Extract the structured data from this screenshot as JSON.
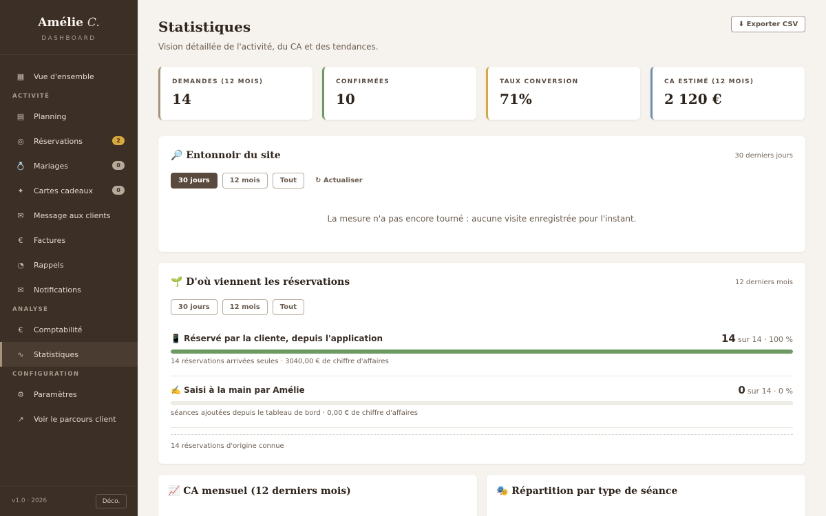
{
  "sidebar": {
    "brand_name": "Amélie",
    "brand_initial": "C.",
    "brand_sub": "DASHBOARD",
    "overview": {
      "label": "Vue d'ensemble",
      "icon": "▦"
    },
    "sections": {
      "activite": "ACTIVITÉ",
      "analyse": "ANALYSE",
      "configuration": "CONFIGURATION"
    },
    "items": {
      "planning": {
        "label": "Planning",
        "icon": "▤"
      },
      "reservations": {
        "label": "Réservations",
        "icon": "◎",
        "badge": "2"
      },
      "mariages": {
        "label": "Mariages",
        "icon": "💍",
        "badge": "0"
      },
      "cartes": {
        "label": "Cartes cadeaux",
        "icon": "✦",
        "badge": "0"
      },
      "message": {
        "label": "Message aux clients",
        "icon": "✉"
      },
      "factures": {
        "label": "Factures",
        "icon": "€"
      },
      "rappels": {
        "label": "Rappels",
        "icon": "◔"
      },
      "notifications": {
        "label": "Notifications",
        "icon": "✉"
      },
      "comptabilite": {
        "label": "Comptabilité",
        "icon": "€"
      },
      "statistiques": {
        "label": "Statistiques",
        "icon": "∿"
      },
      "parametres": {
        "label": "Paramètres",
        "icon": "⚙"
      },
      "parcours": {
        "label": "Voir le parcours client",
        "icon": "↗"
      }
    },
    "version": "v1.0 · 2026",
    "logout": "Déco."
  },
  "header": {
    "title": "Statistiques",
    "subtitle": "Vision détaillée de l'activité, du CA et des tendances.",
    "export": "⬇ Exporter CSV"
  },
  "kpis": [
    {
      "label": "DEMANDES (12 MOIS)",
      "value": "14",
      "color": "#a89378"
    },
    {
      "label": "CONFIRMÉES",
      "value": "10",
      "color": "#6c9a62"
    },
    {
      "label": "TAUX CONVERSION",
      "value": "71%",
      "color": "#d9a93a"
    },
    {
      "label": "CA ESTIMÉ (12 MOIS)",
      "value": "2 120 €",
      "color": "#6d8fb3"
    }
  ],
  "funnel": {
    "title": "🔎 Entonnoir du site",
    "note": "30 derniers jours",
    "pills": [
      "30 jours",
      "12 mois",
      "Tout"
    ],
    "refresh": "↻ Actualiser",
    "empty": "La mesure n'a pas encore tourné : aucune visite enregistrée pour l'instant."
  },
  "sources": {
    "title": "🌱 D'où viennent les réservations",
    "note": "12 derniers mois",
    "pills": [
      "30 jours",
      "12 mois",
      "Tout"
    ],
    "items": [
      {
        "title": "📱 Réservé par la cliente, depuis l'application",
        "count": "14",
        "suffix": "sur 14 · 100 %",
        "fraction": 1.0,
        "desc": "14 réservations arrivées seules · 3040,00 € de chiffre d'affaires"
      },
      {
        "title": "✍️ Saisi à la main par Amélie",
        "count": "0",
        "suffix": "sur 14 · 0 %",
        "fraction": 0.0,
        "desc": "séances ajoutées depuis le tableau de bord · 0,00 € de chiffre d'affaires"
      }
    ],
    "footer": "14 réservations d'origine connue"
  },
  "bottom": {
    "ca_title": "📈 CA mensuel (12 derniers mois)",
    "split_title": "🎭 Répartition par type de séance"
  }
}
